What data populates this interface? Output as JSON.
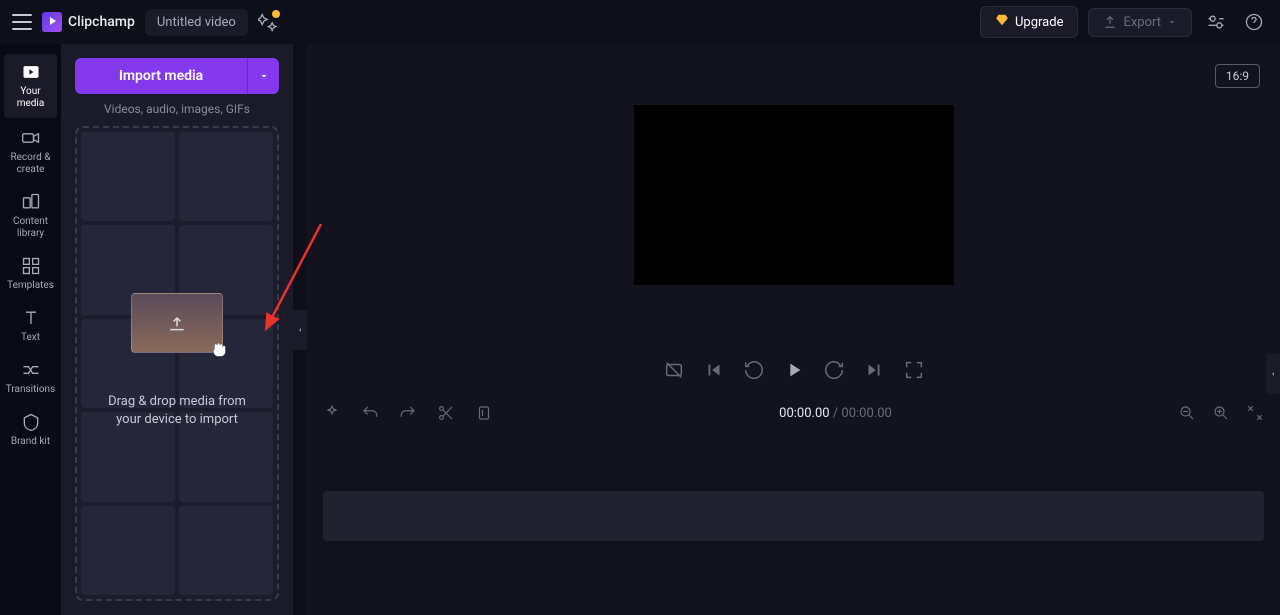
{
  "header": {
    "app_name": "Clipchamp",
    "project_title": "Untitled video",
    "upgrade_label": "Upgrade",
    "export_label": "Export"
  },
  "sidebar": {
    "items": [
      {
        "label": "Your media"
      },
      {
        "label": "Record & create"
      },
      {
        "label": "Content library"
      },
      {
        "label": "Templates"
      },
      {
        "label": "Text"
      },
      {
        "label": "Transitions"
      },
      {
        "label": "Brand kit"
      }
    ]
  },
  "media_panel": {
    "import_label": "Import media",
    "hint": "Videos, audio, images, GIFs",
    "dropzone_text": "Drag & drop media from your device to import"
  },
  "preview": {
    "aspect": "16:9"
  },
  "timeline": {
    "current": "00:00.00",
    "separator": " / ",
    "total": "00:00.00"
  }
}
